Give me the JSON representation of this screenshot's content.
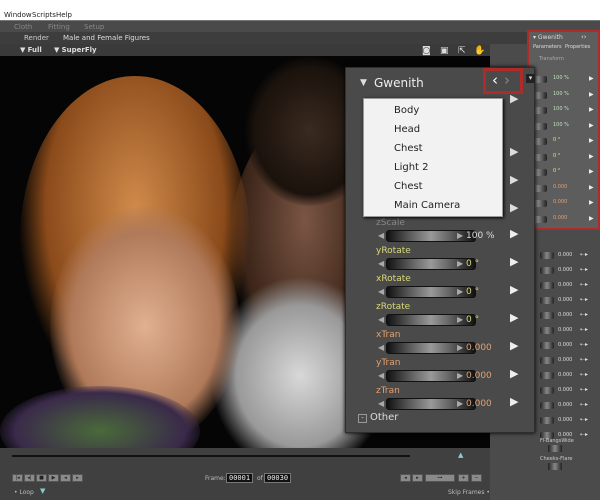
{
  "menu": [
    "Window",
    "Scripts",
    "Help"
  ],
  "rooms": [
    "Cloth",
    "Fitting",
    "Setup"
  ],
  "render_tab": "Render",
  "scene_title": "Male and Female Figures",
  "view_options": [
    "Full",
    "SuperFly"
  ],
  "small_panel": {
    "title": "Gwenith",
    "tabs": [
      "Parameters",
      "Properties"
    ],
    "section": "Transform",
    "values": [
      "100 %",
      "100 %",
      "100 %",
      "100 %",
      "0 °",
      "0 °",
      "0 °",
      "0.000",
      "0.000",
      "0.000"
    ]
  },
  "big_panel": {
    "title": "Gwenith",
    "prev_icon": "chevron-left",
    "next_icon": "chevron-right",
    "params": [
      {
        "label": "zScale",
        "value": "100 %",
        "color": "#888888",
        "value_color": "#dddddd"
      },
      {
        "label": "yRotate",
        "value": "0 °",
        "color": "#d8d87a",
        "value_color": "#d8d87a"
      },
      {
        "label": "xRotate",
        "value": "0 °",
        "color": "#d8d87a",
        "value_color": "#d8d87a"
      },
      {
        "label": "zRotate",
        "value": "0 °",
        "color": "#d8d87a",
        "value_color": "#d8d87a"
      },
      {
        "label": "xTran",
        "value": "0.000",
        "color": "#e0a070",
        "value_color": "#e0a070"
      },
      {
        "label": "yTran",
        "value": "0.000",
        "color": "#e0a070",
        "value_color": "#e0a070"
      },
      {
        "label": "zTran",
        "value": "0.000",
        "color": "#e0a070",
        "value_color": "#e0a070"
      }
    ],
    "other": "Other"
  },
  "dropdown": [
    "Body",
    "Head",
    "Chest",
    "Light 2",
    "Chest",
    "Main Camera"
  ],
  "morph_values": [
    "0.000",
    "0.000",
    "0.000",
    "0.000",
    "0.000",
    "0.000",
    "0.000",
    "0.000",
    "0.000",
    "0.000",
    "0.000",
    "0.000",
    "0.000"
  ],
  "morph_labels": [
    "Fl-BangsWide",
    "Cheeks-Flare"
  ],
  "timeline": {
    "frame_label": "Frame:",
    "frame": "00001",
    "of": "of",
    "total": "00030",
    "loop": "Loop",
    "skip": "Skip Frames"
  },
  "colors": {
    "highlight": "#b02a2a",
    "panel": "#4a4a4a"
  }
}
